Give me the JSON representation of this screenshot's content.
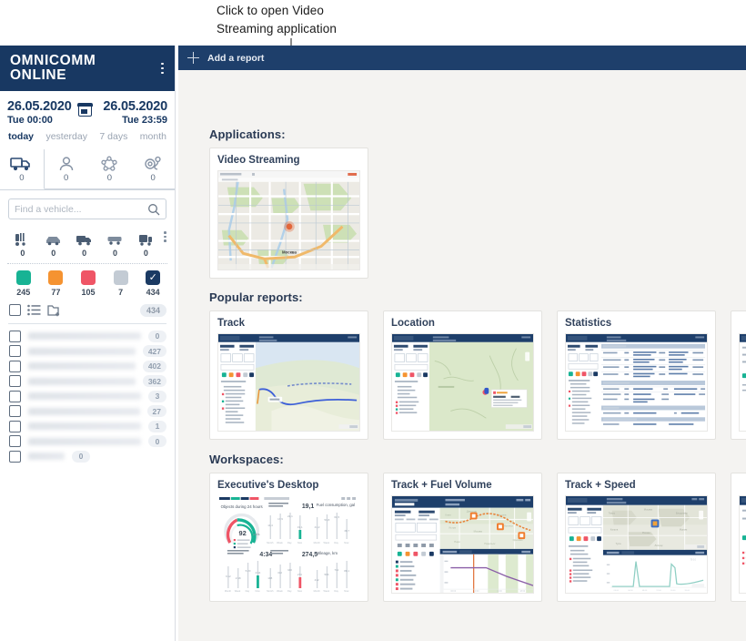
{
  "annotation": {
    "text": "Click to open Video\nStreaming application"
  },
  "sidebar": {
    "brand": "OMNICOMM\nONLINE",
    "menu_icon": "kebab-menu-icon",
    "date_from": {
      "date": "26.05.2020",
      "time": "Tue 00:00"
    },
    "date_to": {
      "date": "26.05.2020",
      "time": "Tue 23:59"
    },
    "calendar_icon": "calendar-icon",
    "quick_ranges": [
      {
        "label": "today",
        "active": true
      },
      {
        "label": "yesterday",
        "active": false
      },
      {
        "label": "7 days",
        "active": false
      },
      {
        "label": "month",
        "active": false
      }
    ],
    "tabs": [
      {
        "icon": "truck-icon",
        "count": "0",
        "active": true
      },
      {
        "icon": "person-icon",
        "count": "0",
        "active": false
      },
      {
        "icon": "geofence-group-icon",
        "count": "0",
        "active": false
      },
      {
        "icon": "geo-point-icon",
        "count": "0",
        "active": false
      }
    ],
    "search": {
      "placeholder": "Find a vehicle...",
      "value": "",
      "icon": "search-icon"
    },
    "vehicle_types": [
      {
        "icon": "fork-lift-icon",
        "count": "0"
      },
      {
        "icon": "car-icon",
        "count": "0"
      },
      {
        "icon": "van-icon",
        "count": "0"
      },
      {
        "icon": "trailer-icon",
        "count": "0"
      },
      {
        "icon": "fuel-tanker-icon",
        "count": "0"
      }
    ],
    "types_more_icon": "kebab-menu-icon",
    "statuses": [
      {
        "color": "#18b394",
        "count": "245",
        "checked": false
      },
      {
        "color": "#f59331",
        "count": "77",
        "checked": false
      },
      {
        "color": "#ef5566",
        "count": "105",
        "checked": false
      },
      {
        "color": "#c3cbd4",
        "count": "7",
        "checked": false
      },
      {
        "color": "#1b3a63",
        "count": "434",
        "checked": true
      }
    ],
    "tools": {
      "select_all_icon": "checkbox-icon",
      "list_view_icon": "list-view-icon",
      "new_group_icon": "new-folder-icon",
      "total_badge": "434"
    },
    "vehicle_rows": [
      {
        "name": "",
        "badge": "0"
      },
      {
        "name": "",
        "badge": "427"
      },
      {
        "name": "",
        "badge": "402"
      },
      {
        "name": "",
        "badge": "362"
      },
      {
        "name": "",
        "badge": "3"
      },
      {
        "name": "",
        "badge": "27"
      },
      {
        "name": "",
        "badge": "1"
      },
      {
        "name": "",
        "badge": "0"
      },
      {
        "name": "",
        "badge": "0"
      }
    ]
  },
  "topbar": {
    "add_label": "Add a report",
    "add_icon": "plus-icon"
  },
  "content": {
    "applications": {
      "title": "Applications:",
      "cards": [
        {
          "title": "Video Streaming",
          "thumb": "map-thumbnail"
        }
      ]
    },
    "popular_reports": {
      "title": "Popular reports:",
      "cards": [
        {
          "title": "Track",
          "thumb": "track-map-thumbnail"
        },
        {
          "title": "Location",
          "thumb": "location-map-thumbnail"
        },
        {
          "title": "Statistics",
          "thumb": "statistics-table-thumbnail"
        },
        {
          "title": "",
          "thumb": "report-thumbnail-partial"
        }
      ]
    },
    "workspaces": {
      "title": "Workspaces:",
      "cards": [
        {
          "title": "Executive's Desktop",
          "thumb": "dashboard-thumbnail"
        },
        {
          "title": "Track + Fuel Volume",
          "thumb": "track-fuel-thumbnail"
        },
        {
          "title": "Track + Speed",
          "thumb": "track-speed-thumbnail"
        },
        {
          "title": "",
          "thumb": "workspace-thumbnail-partial"
        }
      ]
    },
    "dashboard_widgets": {
      "gauge_title": "Objects during 24 hours",
      "gauge_value": "92",
      "gauge_unit": "units",
      "widgets": [
        {
          "label": "Average consumption, l/100km",
          "value": "19,1"
        },
        {
          "label": "Fuel consumption, gal",
          "value": ""
        },
        {
          "label": "Average work time, hours per day",
          "value": "4:34"
        },
        {
          "label": "Mileage, total, gal",
          "value": "274,5"
        },
        {
          "label": "Mileage, km",
          "value": ""
        }
      ]
    }
  },
  "colors": {
    "brand_navy": "#183862",
    "topbar_navy": "#1e3f6b",
    "content_bg": "#f4f3f1",
    "status_green": "#18b394",
    "status_orange": "#f59331",
    "status_red": "#ef5566",
    "status_gray": "#c3cbd4"
  }
}
